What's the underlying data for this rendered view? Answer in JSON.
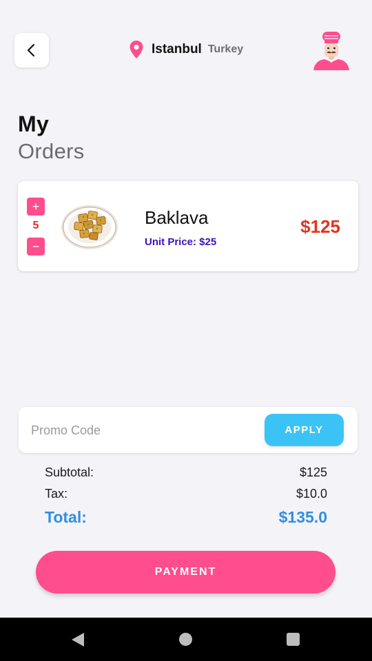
{
  "header": {
    "back_icon": "chevron-left-icon",
    "location_icon": "map-pin-icon",
    "city": "Istanbul",
    "country": "Turkey",
    "avatar_icon": "chef-avatar-icon"
  },
  "title": {
    "line1": "My",
    "line2": "Orders"
  },
  "orders": [
    {
      "name": "Baklava",
      "unit_price": "Unit Price: $25",
      "quantity": "5",
      "price": "$125",
      "plus_label": "+",
      "minus_label": "−",
      "image_icon": "baklava-plate-image"
    }
  ],
  "promo": {
    "placeholder": "Promo Code",
    "value": "",
    "apply_label": "APPLY"
  },
  "summary": {
    "subtotal_label": "Subtotal:",
    "subtotal_value": "$125",
    "tax_label": "Tax:",
    "tax_value": "$10.0",
    "total_label": "Total:",
    "total_value": "$135.0"
  },
  "payment": {
    "label": "PAYMENT"
  },
  "colors": {
    "accent_pink": "#ff4d8d",
    "apply_blue": "#3cc3f5",
    "total_blue": "#2f8fe0",
    "price_red": "#e2341d",
    "unit_price_purple": "#3d12b8",
    "background": "#f4f3f8"
  },
  "system_nav": {
    "back_icon": "nav-back-triangle-icon",
    "home_icon": "nav-home-circle-icon",
    "recent_icon": "nav-recent-square-icon"
  }
}
